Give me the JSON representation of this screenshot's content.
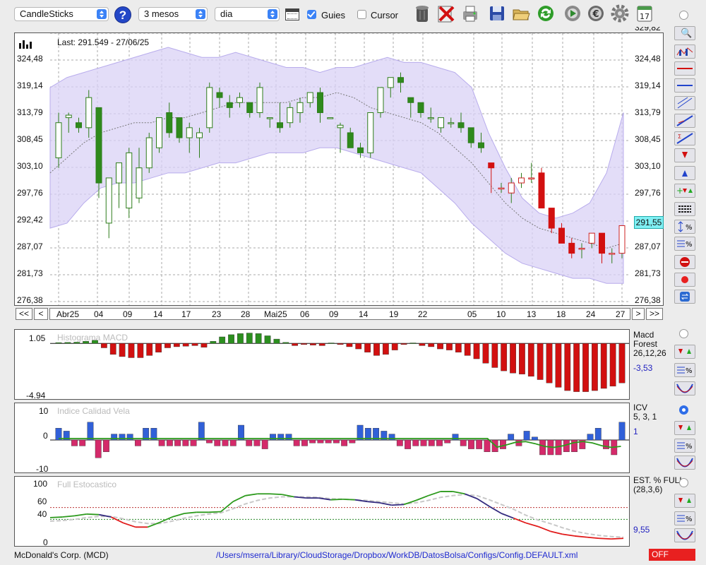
{
  "toolbar": {
    "chart_type": "CandleSticks",
    "period": "3 mesos",
    "interval": "dia",
    "guides_label": "Guies",
    "guides_checked": true,
    "cursor_label": "Cursor",
    "cursor_checked": false
  },
  "main_chart": {
    "last_label": "Last: 291.549 - 27/06/25",
    "current_price_label": "291,55",
    "y_labels": [
      "329,82",
      "324,48",
      "319,14",
      "313,79",
      "308,45",
      "303,10",
      "297,76",
      "292,42",
      "287,07",
      "281,73",
      "276,38"
    ],
    "x_labels": [
      "Abr25",
      "04",
      "09",
      "14",
      "17",
      "23",
      "28",
      "Mai25",
      "06",
      "09",
      "14",
      "19",
      "22",
      "05",
      "10",
      "13",
      "18",
      "24",
      "27"
    ],
    "nav": {
      "first": "<<",
      "prev": "<",
      "next": ">",
      "last": ">>"
    }
  },
  "chart_data": [
    {
      "type": "candlestick",
      "title": "",
      "ylim": [
        276.38,
        329.82
      ],
      "last_close": 291.549,
      "candles": [
        {
          "o": 305,
          "h": 314,
          "l": 303,
          "c": 312
        },
        {
          "o": 313,
          "h": 314,
          "l": 310,
          "c": 313.5
        },
        {
          "o": 312,
          "h": 313,
          "l": 310,
          "c": 311
        },
        {
          "o": 311,
          "h": 318.5,
          "l": 309,
          "c": 317
        },
        {
          "o": 315,
          "h": 315,
          "l": 297,
          "c": 300
        },
        {
          "o": 292,
          "h": 301,
          "l": 289,
          "c": 301
        },
        {
          "o": 300,
          "h": 303,
          "l": 295,
          "c": 304
        },
        {
          "o": 295,
          "h": 307,
          "l": 293,
          "c": 306
        },
        {
          "o": 297,
          "h": 307,
          "l": 296,
          "c": 303
        },
        {
          "o": 303,
          "h": 310,
          "l": 302,
          "c": 309
        },
        {
          "o": 307,
          "h": 312,
          "l": 306,
          "c": 313
        },
        {
          "o": 314,
          "h": 316,
          "l": 309,
          "c": 310
        },
        {
          "o": 313,
          "h": 313,
          "l": 308,
          "c": 309
        },
        {
          "o": 309,
          "h": 312,
          "l": 306,
          "c": 311
        },
        {
          "o": 309,
          "h": 311,
          "l": 305,
          "c": 310
        },
        {
          "o": 311,
          "h": 320,
          "l": 310,
          "c": 319
        },
        {
          "o": 318,
          "h": 319,
          "l": 315,
          "c": 317
        },
        {
          "o": 316,
          "h": 317.5,
          "l": 313,
          "c": 315
        },
        {
          "o": 316,
          "h": 318,
          "l": 315,
          "c": 317
        },
        {
          "o": 316,
          "h": 316,
          "l": 313,
          "c": 314
        },
        {
          "o": 314,
          "h": 320,
          "l": 313,
          "c": 319
        },
        {
          "o": 313,
          "h": 313,
          "l": 311,
          "c": 313
        },
        {
          "o": 312,
          "h": 316,
          "l": 310,
          "c": 311
        },
        {
          "o": 312,
          "h": 316,
          "l": 311,
          "c": 315
        },
        {
          "o": 314,
          "h": 317,
          "l": 312,
          "c": 316
        },
        {
          "o": 316,
          "h": 318,
          "l": 315,
          "c": 318
        },
        {
          "o": 318,
          "h": 319,
          "l": 312,
          "c": 314
        },
        {
          "o": 313,
          "h": 313,
          "l": 313,
          "c": 313
        },
        {
          "o": 311,
          "h": 312,
          "l": 306,
          "c": 311.5
        },
        {
          "o": 310,
          "h": 311,
          "l": 307,
          "c": 307
        },
        {
          "o": 307,
          "h": 308,
          "l": 305,
          "c": 306
        },
        {
          "o": 306,
          "h": 314,
          "l": 305,
          "c": 314
        },
        {
          "o": 314,
          "h": 319,
          "l": 313,
          "c": 319
        },
        {
          "o": 319,
          "h": 321,
          "l": 317,
          "c": 321
        },
        {
          "o": 321,
          "h": 322,
          "l": 318,
          "c": 320
        },
        {
          "o": 317,
          "h": 317,
          "l": 313,
          "c": 316
        },
        {
          "o": 316,
          "h": 316,
          "l": 313,
          "c": 314
        },
        {
          "o": 313,
          "h": 315,
          "l": 312,
          "c": 313
        },
        {
          "o": 311,
          "h": 313,
          "l": 310,
          "c": 313
        },
        {
          "o": 312,
          "h": 313,
          "l": 311,
          "c": 312
        },
        {
          "o": 312,
          "h": 314,
          "l": 310,
          "c": 311
        },
        {
          "o": 311,
          "h": 311,
          "l": 307,
          "c": 308
        },
        {
          "o": 308,
          "h": 310,
          "l": 306,
          "c": 307
        },
        {
          "o": 304,
          "h": 304,
          "l": 298,
          "c": 303
        },
        {
          "o": 299,
          "h": 300,
          "l": 298,
          "c": 299
        },
        {
          "o": 298,
          "h": 301,
          "l": 296,
          "c": 300
        },
        {
          "o": 300,
          "h": 302,
          "l": 299,
          "c": 301
        },
        {
          "o": 301,
          "h": 304,
          "l": 300,
          "c": 301
        },
        {
          "o": 302,
          "h": 303,
          "l": 296,
          "c": 295
        },
        {
          "o": 295,
          "h": 295,
          "l": 290,
          "c": 291
        },
        {
          "o": 291,
          "h": 292,
          "l": 288,
          "c": 288
        },
        {
          "o": 288,
          "h": 289,
          "l": 285,
          "c": 286
        },
        {
          "o": 287,
          "h": 288,
          "l": 285,
          "c": 287
        },
        {
          "o": 288,
          "h": 290,
          "l": 287,
          "c": 290
        },
        {
          "o": 290,
          "h": 290,
          "l": 284,
          "c": 286
        },
        {
          "o": 286,
          "h": 287,
          "l": 284,
          "c": 286
        },
        {
          "o": 286,
          "h": 291,
          "l": 285,
          "c": 291.5
        }
      ],
      "bands": {
        "upper": [
          319,
          321,
          322,
          323,
          324,
          325,
          326,
          327,
          326,
          325,
          325,
          326,
          325,
          324,
          323,
          323,
          322,
          323,
          323,
          324,
          325,
          324,
          324,
          323,
          322,
          319,
          310,
          303,
          297,
          294,
          293,
          294,
          296,
          302,
          314
        ],
        "mid": [
          302,
          305,
          308,
          310,
          311,
          312,
          312,
          313,
          313,
          314,
          315,
          316,
          316,
          316,
          316,
          317,
          317,
          318,
          317,
          315,
          314,
          313,
          312,
          310,
          307,
          304,
          300,
          296,
          293,
          291,
          290,
          289,
          288,
          287,
          288
        ],
        "lower": [
          291,
          292,
          296,
          299,
          300,
          300,
          301,
          302,
          302,
          303,
          304,
          304,
          305,
          306,
          306,
          306,
          307,
          307,
          306,
          305,
          304,
          303,
          302,
          299,
          296,
          292,
          289,
          286,
          284,
          283,
          282,
          281,
          281,
          280,
          280
        ]
      }
    },
    {
      "type": "bar",
      "title": "Histograma MACD",
      "params": "26,12,26",
      "series_name": "Forest",
      "ylim": [
        -4.94,
        1.05
      ],
      "last_value": -3.53,
      "values": [
        0.08,
        0.1,
        0.12,
        0.2,
        0.3,
        -0.4,
        -1.0,
        -1.2,
        -1.3,
        -1.3,
        -1.1,
        -0.8,
        -0.4,
        -0.3,
        -0.25,
        -0.2,
        -0.35,
        0.2,
        0.6,
        0.8,
        0.9,
        0.95,
        0.9,
        0.7,
        0.4,
        0.1,
        -0.2,
        -0.1,
        -0.15,
        -0.2,
        0.05,
        -0.1,
        -0.3,
        -0.5,
        -0.8,
        -1.1,
        -1.0,
        -0.6,
        -0.1,
        0.05,
        -0.2,
        -0.3,
        -0.5,
        -0.6,
        -0.8,
        -1.1,
        -1.4,
        -1.8,
        -2.2,
        -2.5,
        -2.7,
        -2.8,
        -3.0,
        -3.3,
        -3.6,
        -4.0,
        -4.3,
        -4.4,
        -4.4,
        -4.3,
        -4.1,
        -3.9,
        -3.6
      ]
    },
    {
      "type": "bar",
      "title": "Indice Calidad Vela",
      "params": "5, 3, 1",
      "series_name": "ICV",
      "ylim": [
        -10,
        10
      ],
      "last_value": 1,
      "values": [
        4,
        3,
        -2,
        -2,
        6,
        -6,
        -4,
        2,
        2,
        2,
        -2,
        4,
        4,
        -2,
        -2,
        -2,
        -2,
        -2,
        6,
        -1,
        -2,
        -2,
        -2,
        5,
        -2,
        -2,
        -3,
        2,
        2,
        2,
        -2,
        -2,
        -1,
        -1,
        -1,
        -1,
        -2,
        -1,
        5,
        4,
        4,
        3,
        2,
        -2,
        -3,
        -2,
        -2,
        -2,
        -2,
        -1,
        2,
        -2,
        -3,
        -3,
        -4,
        -4,
        -3,
        2,
        -2,
        3,
        1,
        -5,
        -5,
        -5,
        -4,
        -4,
        -3,
        2,
        4,
        -3,
        -5,
        6
      ]
    },
    {
      "type": "line",
      "title": "Full Estocastico",
      "params": "(28,3,6)",
      "series_name": "EST. % FULL",
      "ylim": [
        0,
        100
      ],
      "levels": [
        60,
        40
      ],
      "last_value": 9.55,
      "x": [
        0,
        1,
        2,
        3,
        4,
        5,
        6,
        7,
        8,
        9,
        10,
        11,
        12,
        13,
        14,
        15,
        16,
        17,
        18,
        19,
        20,
        21,
        22,
        23,
        24,
        25,
        26,
        27,
        28,
        29,
        30,
        31,
        32,
        33,
        34,
        35,
        36,
        37,
        38,
        39,
        40,
        41,
        42,
        43,
        44,
        45,
        46,
        47
      ],
      "k": [
        43,
        44,
        46,
        49,
        48,
        44,
        34,
        27,
        27,
        35,
        44,
        50,
        52,
        52,
        53,
        70,
        80,
        83,
        83,
        82,
        78,
        76,
        76,
        73,
        74,
        73,
        70,
        68,
        64,
        65,
        72,
        80,
        87,
        87,
        83,
        75,
        62,
        50,
        42,
        34,
        28,
        20,
        15,
        12,
        10,
        8,
        7,
        8
      ],
      "d": [
        37,
        38,
        40,
        43,
        45,
        45,
        41,
        36,
        33,
        33,
        37,
        42,
        46,
        49,
        51,
        58,
        66,
        72,
        76,
        78,
        78,
        78,
        77,
        75,
        74,
        73,
        72,
        70,
        68,
        66,
        68,
        72,
        77,
        80,
        82,
        80,
        73,
        65,
        57,
        47,
        39,
        33,
        26,
        20,
        16,
        13,
        11,
        10
      ]
    }
  ],
  "footer": {
    "company": "McDonald's Corp. (MCD)",
    "path": "/Users/mserra/Library/CloudStorage/Dropbox/WorkDB/DatosBolsa/Configs/Config.DEFAULT.xml",
    "status": "OFF"
  },
  "icons": [
    "help-icon",
    "calendar-icon",
    "trash-icon",
    "delete-icon",
    "print-icon",
    "save-icon",
    "open-folder-icon",
    "refresh-icon",
    "play-icon",
    "euro-icon",
    "settings-icon",
    "date-17-icon"
  ],
  "colors": {
    "up": "#3a8a1e",
    "down": "#d21010",
    "macd_pos": "#2c8f1f",
    "icv_pos": "#3160d8",
    "icv_neg": "#d42a6a",
    "band": "#d9d2f5",
    "status": "#e82020",
    "k_up": "#2c9a1c",
    "k_down": "#e11a1a",
    "k_mid": "#332a7e"
  }
}
